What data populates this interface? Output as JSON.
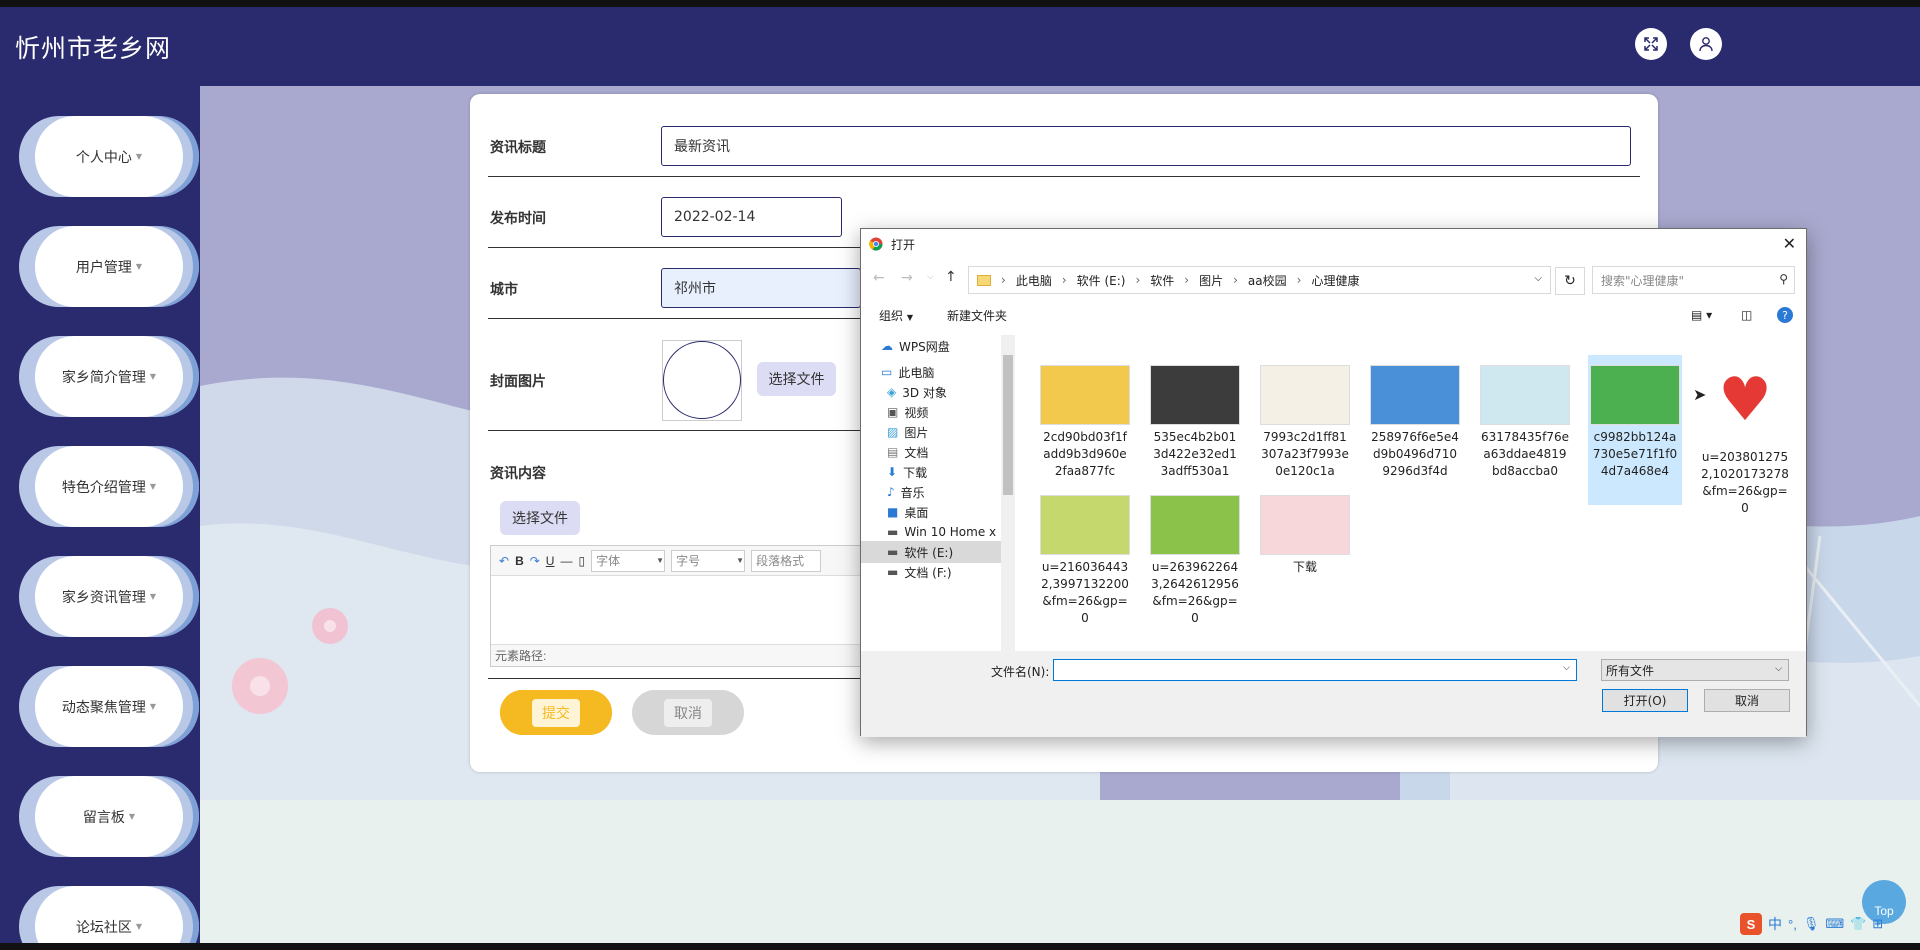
{
  "app": {
    "title": "忻州市老乡网"
  },
  "header": {
    "fullscreen_icon": "expand-icon",
    "user_icon": "user-icon"
  },
  "sidebar": {
    "items": [
      {
        "label": "个人中心"
      },
      {
        "label": "用户管理"
      },
      {
        "label": "家乡简介管理"
      },
      {
        "label": "特色介绍管理"
      },
      {
        "label": "家乡资讯管理"
      },
      {
        "label": "动态聚焦管理"
      },
      {
        "label": "留言板"
      },
      {
        "label": "论坛社区"
      }
    ]
  },
  "form": {
    "title_label": "资讯标题",
    "title_value": "最新资讯",
    "date_label": "发布时间",
    "date_value": "2022-02-14",
    "city_label": "城市",
    "city_value": "祁州市",
    "cover_label": "封面图片",
    "cover_button": "选择文件",
    "content_label": "资讯内容",
    "content_button": "选择文件",
    "editor": {
      "bold": "B",
      "underline": "U",
      "font_placeholder": "字体",
      "size_placeholder": "字号",
      "paragraph_placeholder": "段落格式",
      "path_label": "元素路径:"
    },
    "submit_label": "提交",
    "cancel_label": "取消"
  },
  "dialog": {
    "title": "打开",
    "breadcrumb": [
      "此电脑",
      "软件 (E:)",
      "软件",
      "图片",
      "aa校园",
      "心理健康"
    ],
    "search_placeholder": "搜索\"心理健康\"",
    "toolbar": {
      "organize": "组织",
      "new_folder": "新建文件夹"
    },
    "tree": [
      {
        "label": "WPS网盘",
        "icon": "cloud-icon"
      },
      {
        "label": "此电脑",
        "icon": "computer-icon"
      },
      {
        "label": "3D 对象",
        "icon": "cube-icon"
      },
      {
        "label": "视频",
        "icon": "video-icon"
      },
      {
        "label": "图片",
        "icon": "picture-icon"
      },
      {
        "label": "文档",
        "icon": "document-icon"
      },
      {
        "label": "下载",
        "icon": "download-icon"
      },
      {
        "label": "音乐",
        "icon": "music-icon"
      },
      {
        "label": "桌面",
        "icon": "desktop-icon"
      },
      {
        "label": "Win 10 Home x",
        "icon": "drive-icon"
      },
      {
        "label": "软件 (E:)",
        "icon": "drive-icon"
      },
      {
        "label": "文档 (F:)",
        "icon": "drive-icon"
      }
    ],
    "files": [
      {
        "name": "2cd90bd03f1fadd9b3d960e2faa877fc",
        "color": "#f2c94c"
      },
      {
        "name": "535ec4b2b013d422e32ed13adff530a1",
        "color": "#3c3c3c"
      },
      {
        "name": "7993c2d1ff81307a23f7993e0e120c1a",
        "color": "#f4f0e6"
      },
      {
        "name": "258976f6e5e4d9b0496d7109296d3f4d",
        "color": "#4a90d9"
      },
      {
        "name": "63178435f76ea63ddae4819bd8accba0",
        "color": "#cfe8f0"
      },
      {
        "name": "c9982bb124a730e5e71f1f04d7a468e4",
        "color": "#4caf50"
      },
      {
        "name": "u=2038012752,1020173278&fm=26&gp=0",
        "color": "#e53935"
      },
      {
        "name": "u=2160364432,3997132200&fm=26&gp=0",
        "color": "#c5d86d"
      },
      {
        "name": "u=2639622643,2642612956&fm=26&gp=0",
        "color": "#8bc34a"
      },
      {
        "name": "下载",
        "color": "#f8d7da"
      }
    ],
    "filename_label": "文件名(N):",
    "filename_value": "",
    "filetype_value": "所有文件",
    "open_label": "打开(O)",
    "cancel_label": "取消"
  },
  "misc": {
    "top_button": "Top",
    "ime_label": "中"
  }
}
